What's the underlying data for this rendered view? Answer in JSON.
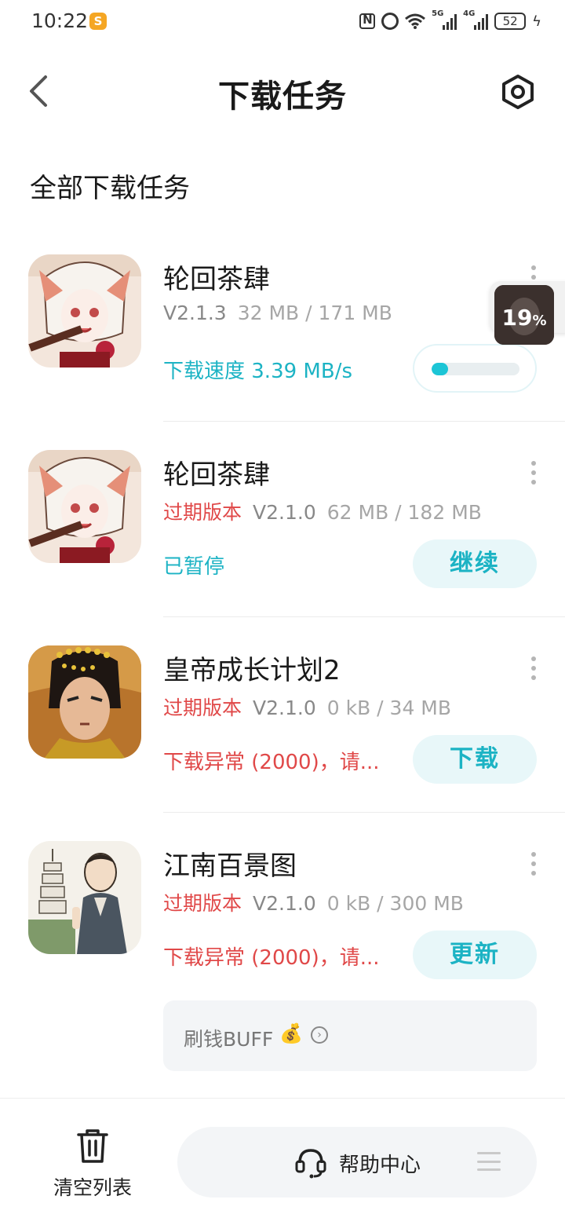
{
  "status_bar": {
    "time": "10:22",
    "network_1": "5G",
    "network_2": "4G",
    "battery": "52"
  },
  "header": {
    "title": "下载任务"
  },
  "section_title": "全部下载任务",
  "tasks": [
    {
      "name": "轮回茶肆",
      "expired_tag": "",
      "version": "V2.1.3",
      "size": "32 MB / 171 MB",
      "status": "下载速度 3.39 MB/s",
      "action": "",
      "progress": 0.19
    },
    {
      "name": "轮回茶肆",
      "expired_tag": "过期版本",
      "version": "V2.1.0",
      "size": "62 MB / 182 MB",
      "status": "已暂停",
      "action": "继续"
    },
    {
      "name": "皇帝成长计划2",
      "expired_tag": "过期版本",
      "version": "V2.1.0",
      "size": "0 kB / 34 MB",
      "status": "下载异常 (2000)，请...",
      "action": "下载"
    },
    {
      "name": "江南百景图",
      "expired_tag": "过期版本",
      "version": "V2.1.0",
      "size": "0 kB / 300 MB",
      "status": "下载异常 (2000)，请...",
      "action": "更新"
    }
  ],
  "floating_widget": {
    "percent": "19",
    "percent_sign": "%"
  },
  "buff_banner": {
    "label": "刷钱BUFF"
  },
  "bottom_bar": {
    "clear_label": "清空列表",
    "help_label": "帮助中心"
  },
  "colors": {
    "accent": "#1cb3c4",
    "error": "#e04848",
    "button_bg": "#e8f7f9"
  }
}
